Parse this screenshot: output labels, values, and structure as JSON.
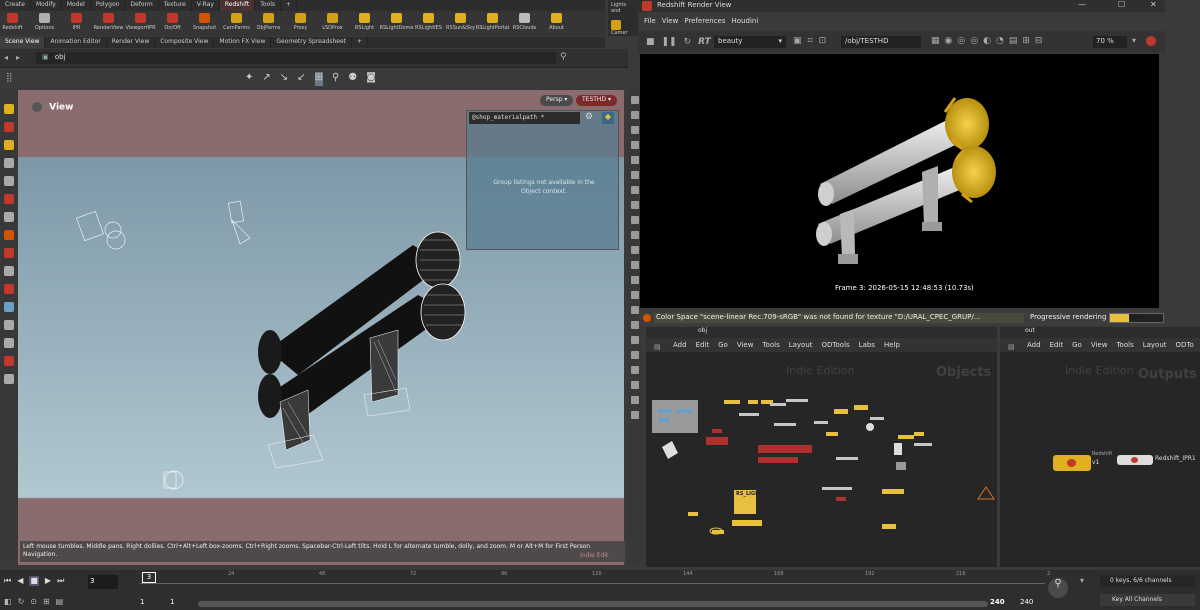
{
  "shelf": {
    "tabs": [
      "Create",
      "Modify",
      "Model",
      "Polygon",
      "Deform",
      "Texture",
      "V-Ray",
      "Redshift",
      "Tools"
    ],
    "active_tab": "Redshift",
    "plus": "+",
    "right_tab": "Lights and",
    "right_tool": "Camer",
    "tools": [
      {
        "label": "Redshift",
        "color": "#c0392b"
      },
      {
        "label": "Options",
        "color": "#b0b0b0"
      },
      {
        "label": "IPR",
        "color": "#c0392b"
      },
      {
        "label": "RenderView",
        "color": "#c0392b"
      },
      {
        "label": "ViewportIPR",
        "color": "#c0392b"
      },
      {
        "label": "On/Off",
        "color": "#c0392b"
      },
      {
        "label": "Snapshot",
        "color": "#d35400"
      },
      {
        "label": "CamParms",
        "color": "#d4a017"
      },
      {
        "label": "ObjParms",
        "color": "#d4a017"
      },
      {
        "label": "Proxy",
        "color": "#d4a017"
      },
      {
        "label": "LSDProx",
        "color": "#d4a017"
      },
      {
        "label": "RSLight",
        "color": "#e0b020"
      },
      {
        "label": "RSLightDome",
        "color": "#e0b020"
      },
      {
        "label": "RSLightIES",
        "color": "#e0b020"
      },
      {
        "label": "RSSun&Sky",
        "color": "#e0b020"
      },
      {
        "label": "RSLightPortal",
        "color": "#e0b020"
      },
      {
        "label": "RSClouds",
        "color": "#bbbbbb"
      },
      {
        "label": "About",
        "color": "#e0b020"
      }
    ]
  },
  "pane_tabs": [
    "Scene View",
    "Animation Editor",
    "Render View",
    "Composite View",
    "Motion FX View",
    "Geometry Spreadsheet",
    "+"
  ],
  "path": "obj",
  "viewport": {
    "title": "View",
    "persp": "Persp ▾",
    "camera": "TESTHD ▾",
    "material_field": "@shop_materialpath *",
    "material_message": "Group listings not available in the Object context.",
    "hint": "Left mouse tumbles. Middle pans. Right dollies. Ctrl+Alt+Left box-zooms. Ctrl+Right zooms. Spacebar-Ctrl-Left tilts. Hold L for alternate tumble, dolly, and zoom. M or Alt+M for First Person Navigation.",
    "edition": "Indie Edit"
  },
  "render_view": {
    "title": "Redshift Render View",
    "menu": [
      "File",
      "View",
      "Preferences",
      "Houdini"
    ],
    "aov": "beauty",
    "camera_path": "/obj/TESTHD",
    "zoom": "70 %",
    "frame_info": "Frame  3:  2026-05-15  12:48:53  (10.73s)",
    "status_message": "Color Space \"scene-linear Rec.709-sRGB\" was not found for texture \"D:/URAL_CPEC_GRUP/...",
    "progress_label": "Progressive rendering",
    "progress_percent": 36,
    "progress_text": "36%",
    "win_min": "—",
    "win_max": "☐",
    "win_close": "✕"
  },
  "network_left": {
    "path": "obj",
    "menu": [
      "Add",
      "Edit",
      "Go",
      "View",
      "Tools",
      "Layout",
      "ODTools",
      "Labs",
      "Help"
    ],
    "watermark": "Indie Edition",
    "context": "Objects",
    "node_label": "RS_LIGHT"
  },
  "network_right": {
    "path": "out",
    "menu": [
      "Add",
      "Edit",
      "Go",
      "View",
      "Tools",
      "Layout",
      "ODTo"
    ],
    "watermark": "Indie Edition",
    "context": "Outputs",
    "node1_label": "Redshift",
    "node1_sub": "v1",
    "node2_label": "Redshift_IPR1"
  },
  "timeline": {
    "current_frame": "3",
    "marker": "3",
    "ticks": [
      "24",
      "48",
      "72",
      "96",
      "120",
      "144",
      "168",
      "192",
      "216",
      "2"
    ],
    "start": "1",
    "start2": "1",
    "end": "240",
    "end2": "240",
    "keys": "0 keys, 6/6 channels",
    "key_all": "Key All Channels"
  }
}
